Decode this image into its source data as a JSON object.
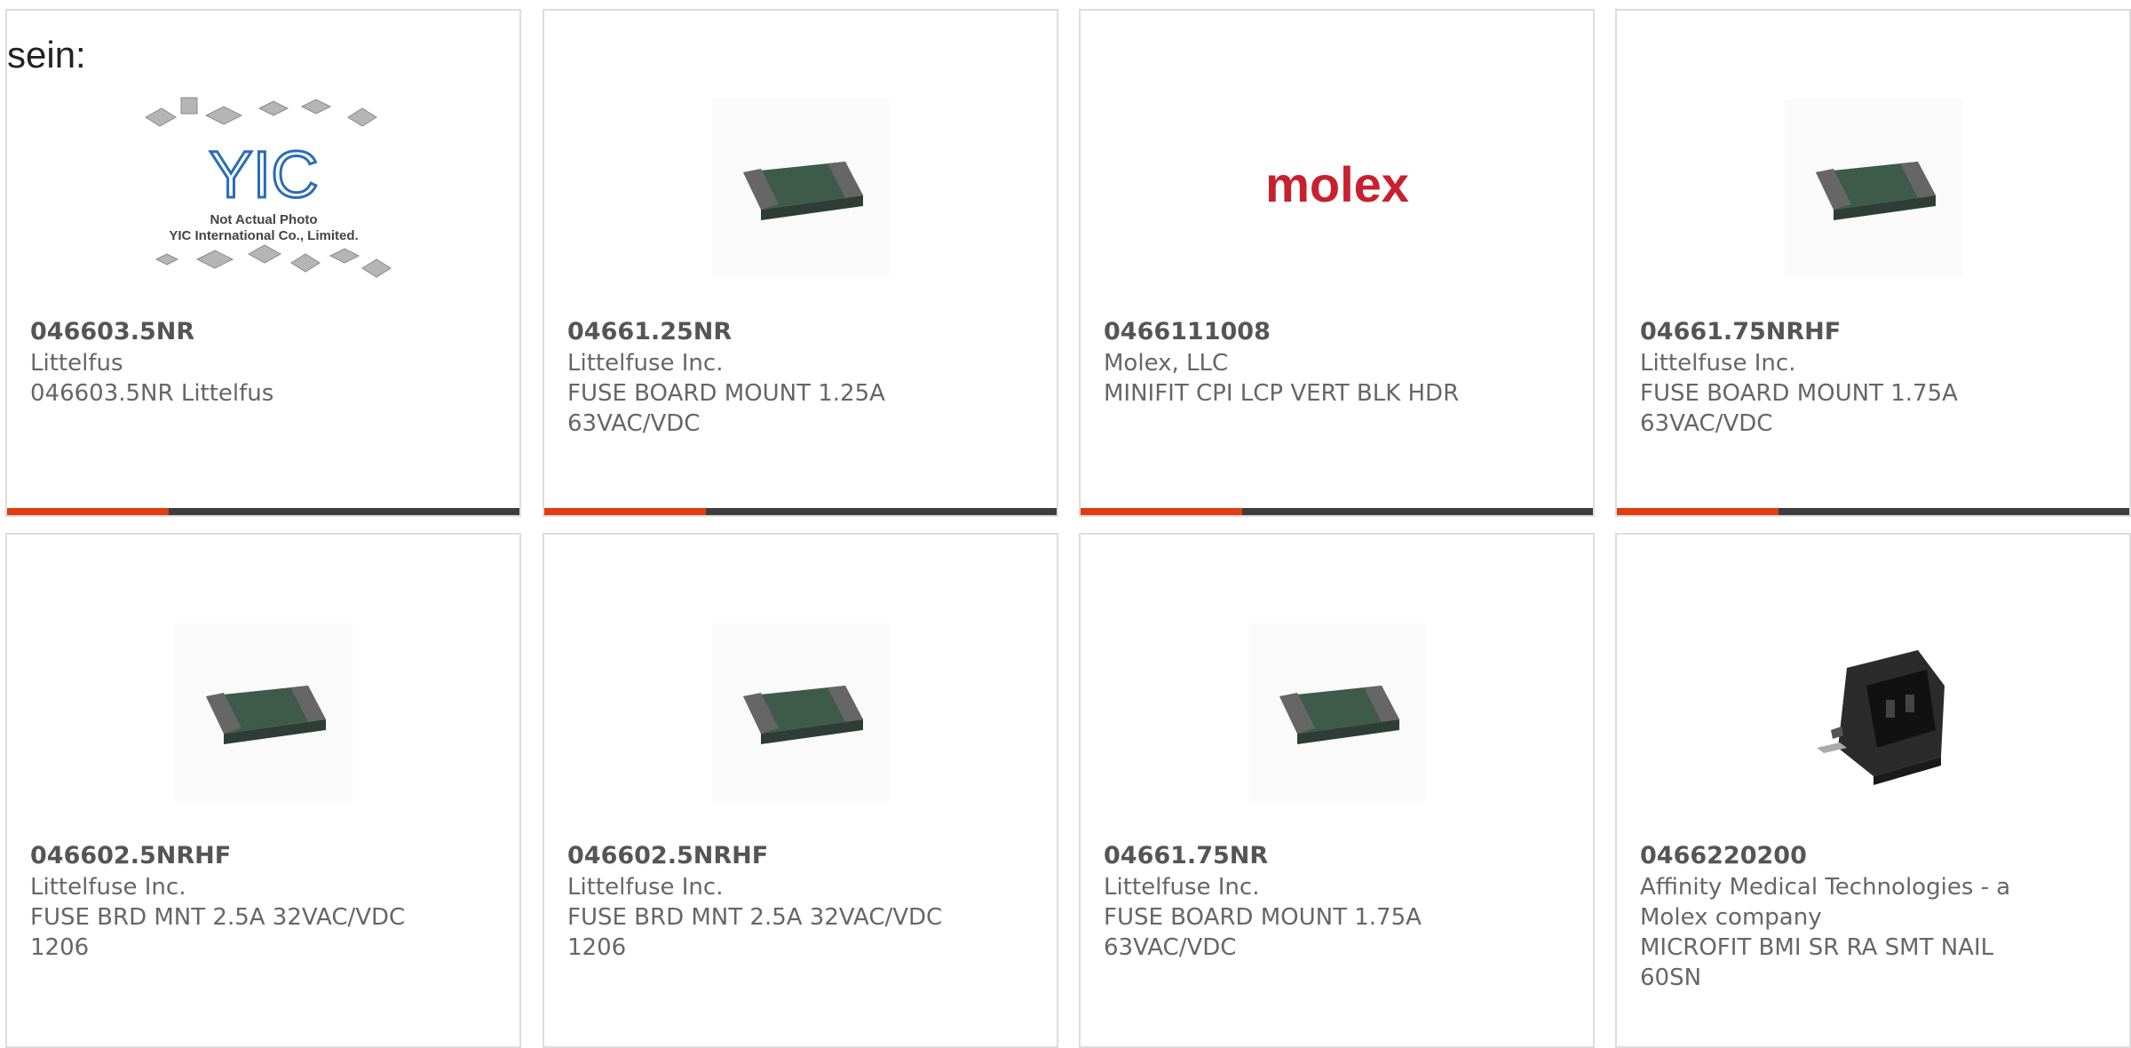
{
  "lead_text": "sein:",
  "placeholder_image": {
    "caption_line1": "Not Actual Photo",
    "caption_line2": "YIC International Co., Limited.",
    "logo_text": "YIC"
  },
  "molex_logo_text": "molex",
  "colors": {
    "accent": "#e03d12",
    "bar_dark": "#3d3d3d",
    "card_border": "#dddddd"
  },
  "products": [
    {
      "part": "046603.5NR",
      "manufacturer": "Littelfus",
      "description": "046603.5NR Littelfus",
      "image": "placeholder-photo"
    },
    {
      "part": "04661.25NR",
      "manufacturer": "Littelfuse Inc.",
      "description": "FUSE BOARD MOUNT 1.25A 63VAC/VDC",
      "image": "smd-fuse"
    },
    {
      "part": "0466111008",
      "manufacturer": "Molex, LLC",
      "description": "MINIFIT CPI LCP VERT BLK HDR",
      "image": "molex-logo"
    },
    {
      "part": "04661.75NRHF",
      "manufacturer": "Littelfuse Inc.",
      "description": "FUSE BOARD MOUNT 1.75A 63VAC/VDC",
      "image": "smd-fuse"
    },
    {
      "part": "046602.5NRHF",
      "manufacturer": "Littelfuse Inc.",
      "description": "FUSE BRD MNT 2.5A 32VAC/VDC 1206",
      "image": "smd-fuse"
    },
    {
      "part": "046602.5NRHF",
      "manufacturer": "Littelfuse Inc.",
      "description": "FUSE BRD MNT 2.5A 32VAC/VDC 1206",
      "image": "smd-fuse"
    },
    {
      "part": "04661.75NR",
      "manufacturer": "Littelfuse Inc.",
      "description": "FUSE BOARD MOUNT 1.75A 63VAC/VDC",
      "image": "smd-fuse"
    },
    {
      "part": "0466220200",
      "manufacturer": "Affinity Medical Technologies - a Molex company",
      "description": "MICROFIT BMI SR RA SMT NAIL 60SN",
      "image": "connector"
    }
  ]
}
